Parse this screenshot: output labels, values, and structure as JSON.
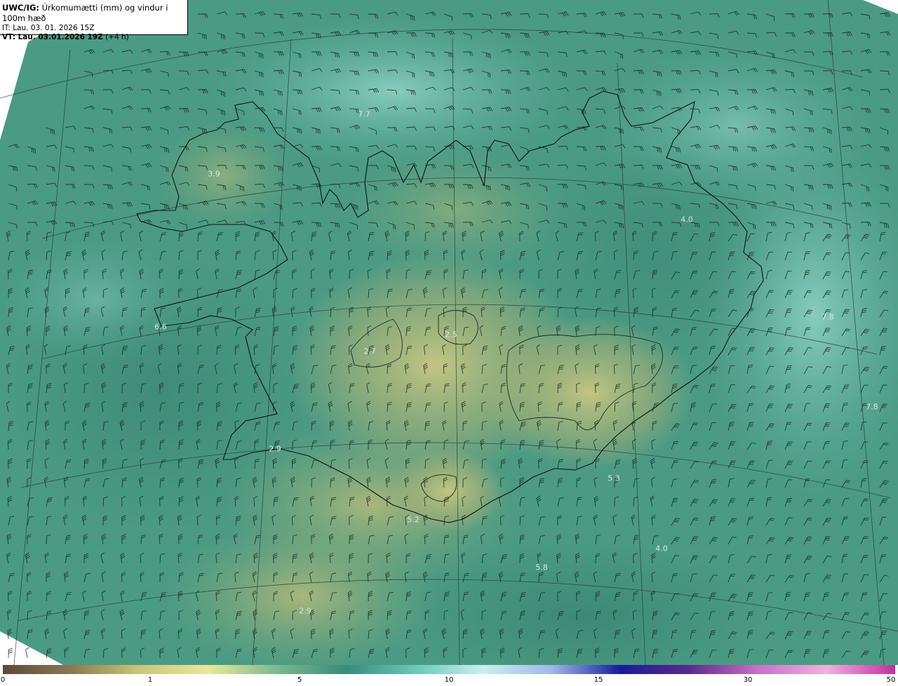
{
  "header": {
    "product": "UWC/IG:",
    "title_rest": " Úrkomumætti (mm) og vindur i 100m hæð",
    "it_line": "IT: Lau. 03. 01. 2026 15Z",
    "vt_bold": "VT: Lau. 03.01.2026 19Z",
    "vt_rest": " (+4 h)"
  },
  "map_labels": [
    {
      "text": "7.7",
      "id": "pw-label-nw-sea"
    },
    {
      "text": "3.9",
      "id": "pw-label-westfjords"
    },
    {
      "text": "4.0",
      "id": "pw-label-northeast"
    },
    {
      "text": "6.6",
      "id": "pw-label-snaefellsnes"
    },
    {
      "text": "2.7",
      "id": "pw-label-langjokull"
    },
    {
      "text": "2.5",
      "id": "pw-label-hofsjokull"
    },
    {
      "text": "7.8",
      "id": "pw-label-east-sea"
    },
    {
      "text": "7.8",
      "id": "pw-label-far-east"
    },
    {
      "text": "2.9",
      "id": "pw-label-reykjanes"
    },
    {
      "text": "5.3",
      "id": "pw-label-south-coast"
    },
    {
      "text": "5.2",
      "id": "pw-label-south-sea"
    },
    {
      "text": "4.0",
      "id": "pw-label-southeast-sea"
    },
    {
      "text": "5.8",
      "id": "pw-label-south-far"
    },
    {
      "text": "2.9",
      "id": "pw-label-southwest-sea"
    }
  ],
  "colorbar": {
    "ticks": [
      "0",
      "1",
      "5",
      "10",
      "15",
      "30",
      "50"
    ],
    "colors": [
      "#5c4a3a",
      "#8a7a52",
      "#c8c87a",
      "#e8e89a",
      "#7ab890",
      "#3a8a78",
      "#6ac8b8",
      "#c8f0f0",
      "#a0b8e8",
      "#1a1a9a",
      "#5a2a8a",
      "#c870c8",
      "#f0b0e0",
      "#c030a0"
    ]
  }
}
